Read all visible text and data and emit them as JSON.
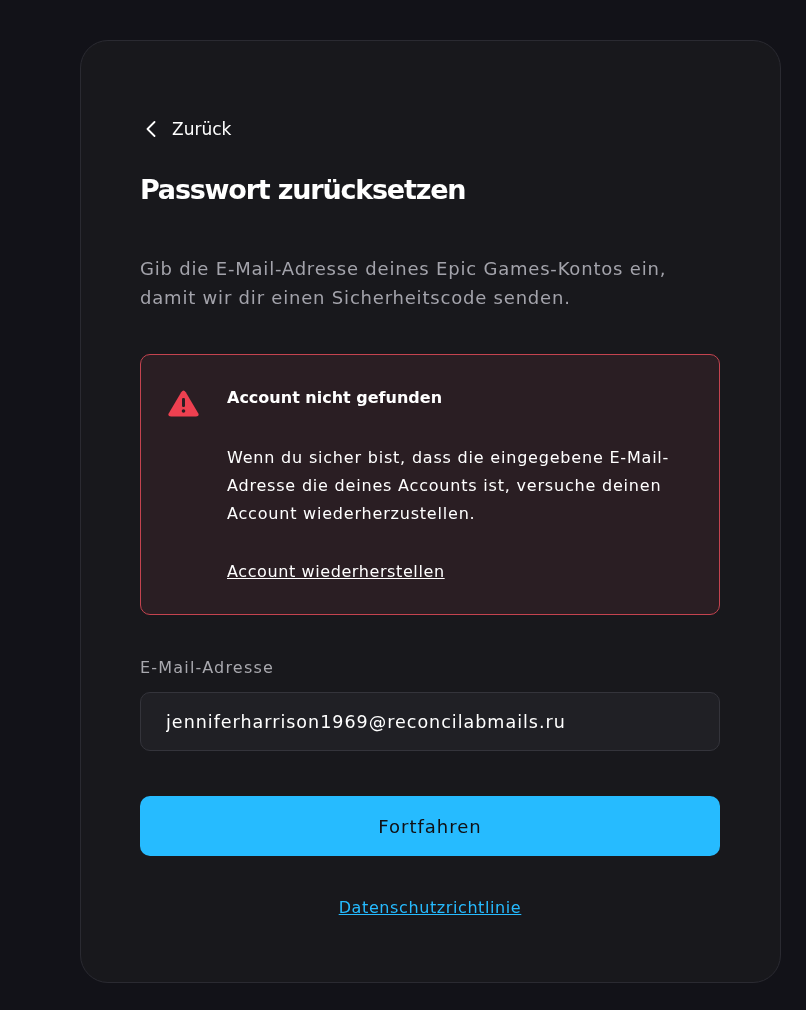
{
  "back_link": {
    "label": "Zurück"
  },
  "title": "Passwort zurücksetzen",
  "description": "Gib die E-Mail-Adresse deines Epic Games-Kontos ein, damit wir dir einen Sicherheitscode senden.",
  "alert": {
    "kind": "error",
    "title": "Account nicht gefunden",
    "message": "Wenn du sicher bist, dass die eingegebene E-Mail-Adresse die deines Accounts ist, versuche deinen Account wiederherzustellen.",
    "link": "Account wiederherstellen"
  },
  "email_field": {
    "label": "E-Mail-Adresse",
    "value": "jenniferharrison1969@reconcilabmails.ru"
  },
  "submit_button": {
    "label": "Fortfahren"
  },
  "footer_link": {
    "label": "Datenschutzrichtlinie"
  }
}
